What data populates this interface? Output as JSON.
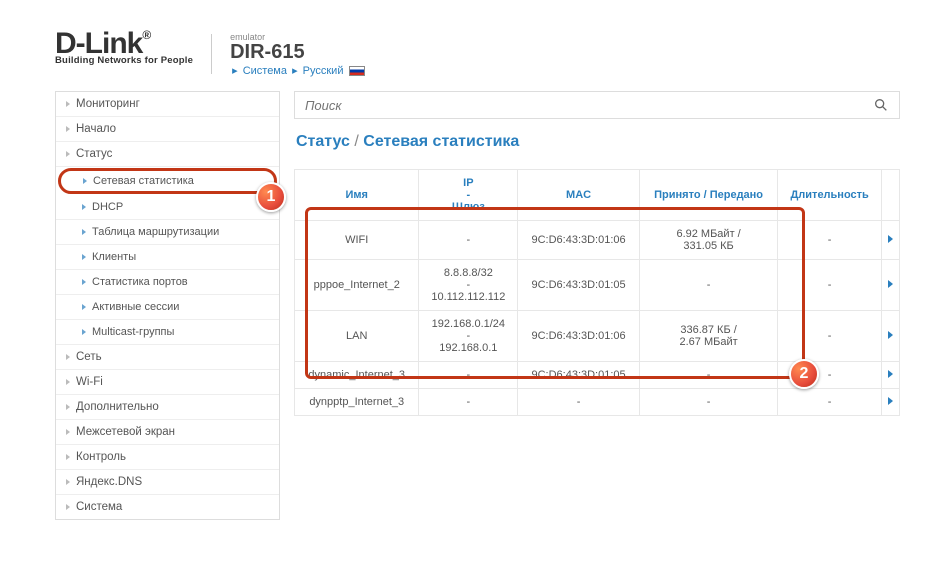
{
  "header": {
    "logo_main": "D-Link",
    "logo_sub": "Building Networks for People",
    "emulator": "emulator",
    "model": "DIR-615",
    "breadcrumb": {
      "item1": "Система",
      "item2": "Русский"
    }
  },
  "search": {
    "placeholder": "Поиск"
  },
  "page_title": {
    "section": "Статус",
    "page": "Сетевая статистика"
  },
  "sidebar": {
    "items": [
      {
        "label": "Мониторинг"
      },
      {
        "label": "Начало"
      },
      {
        "label": "Статус"
      },
      {
        "label": "Сетевая статистика"
      },
      {
        "label": "DHCP"
      },
      {
        "label": "Таблица маршрутизации"
      },
      {
        "label": "Клиенты"
      },
      {
        "label": "Статистика портов"
      },
      {
        "label": "Активные сессии"
      },
      {
        "label": "Multicast-группы"
      },
      {
        "label": "Сеть"
      },
      {
        "label": "Wi-Fi"
      },
      {
        "label": "Дополнительно"
      },
      {
        "label": "Межсетевой экран"
      },
      {
        "label": "Контроль"
      },
      {
        "label": "Яндекс.DNS"
      },
      {
        "label": "Система"
      }
    ]
  },
  "table": {
    "headers": {
      "name": "Имя",
      "ip": "IP\n-\nШлюз",
      "mac": "MAC",
      "rxtx": "Принято / Передано",
      "dur": "Длительность"
    },
    "rows": [
      {
        "name": "WIFI",
        "cls": "green",
        "ip": "-",
        "mac": "9C:D6:43:3D:01:06",
        "rxtx": "6.92 МБайт / 331.05 КБ",
        "dur": "-"
      },
      {
        "name": "pppoe_Internet_2",
        "cls": "red",
        "ip": "8.8.8.8/32\n-\n10.112.112.112",
        "mac": "9C:D6:43:3D:01:05",
        "rxtx": "-",
        "dur": "-"
      },
      {
        "name": "LAN",
        "cls": "green",
        "ip": "192.168.0.1/24\n-\n192.168.0.1",
        "mac": "9C:D6:43:3D:01:06",
        "rxtx": "336.87 КБ / 2.67 МБайт",
        "dur": "-"
      },
      {
        "name": "dynamic_Internet_3",
        "cls": "red",
        "ip": "-",
        "mac": "9C:D6:43:3D:01:05",
        "rxtx": "-",
        "dur": "-"
      },
      {
        "name": "dynpptp_Internet_3",
        "cls": "red",
        "ip": "-",
        "mac": "-",
        "rxtx": "-",
        "dur": "-"
      }
    ]
  },
  "callouts": {
    "b1": "1",
    "b2": "2"
  }
}
